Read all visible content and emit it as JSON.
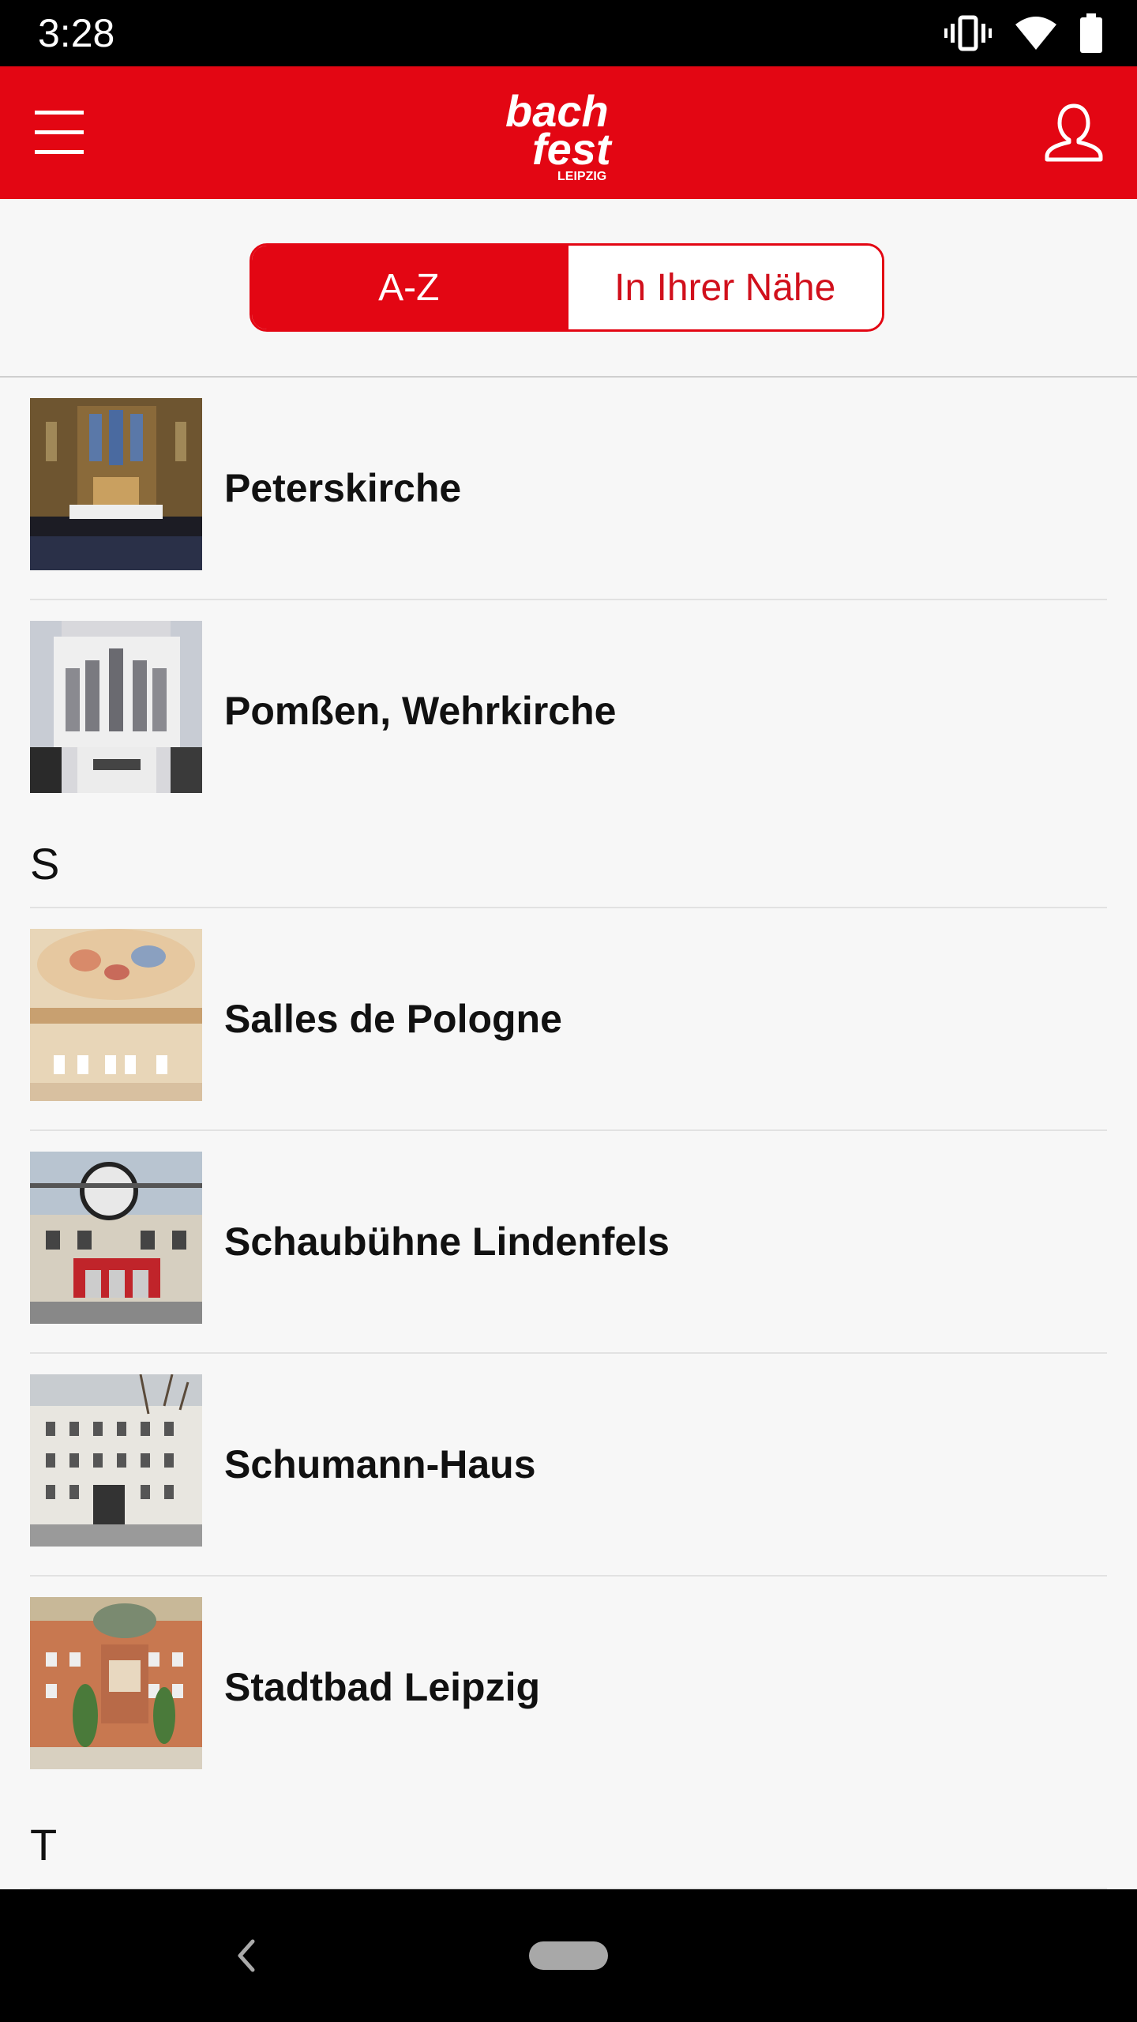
{
  "status_bar": {
    "time": "3:28",
    "icons": [
      "vibrate-icon",
      "wifi-icon",
      "battery-icon"
    ]
  },
  "header": {
    "logo_text_line1": "bach",
    "logo_text_line2": "fest",
    "logo_text_line3": "LEIPZIG",
    "brand_color": "#e30613"
  },
  "tabs": {
    "az": "A-Z",
    "nearby": "In Ihrer Nähe",
    "selected": "A-Z"
  },
  "list": {
    "group_p": [
      {
        "title": "Peterskirche"
      },
      {
        "title": "Pomßen, Wehrkirche"
      }
    ],
    "section_s": "S",
    "group_s": [
      {
        "title": "Salles de Pologne"
      },
      {
        "title": "Schaubühne Lindenfels"
      },
      {
        "title": "Schumann-Haus"
      },
      {
        "title": "Stadtbad Leipzig"
      }
    ],
    "section_t": "T"
  }
}
